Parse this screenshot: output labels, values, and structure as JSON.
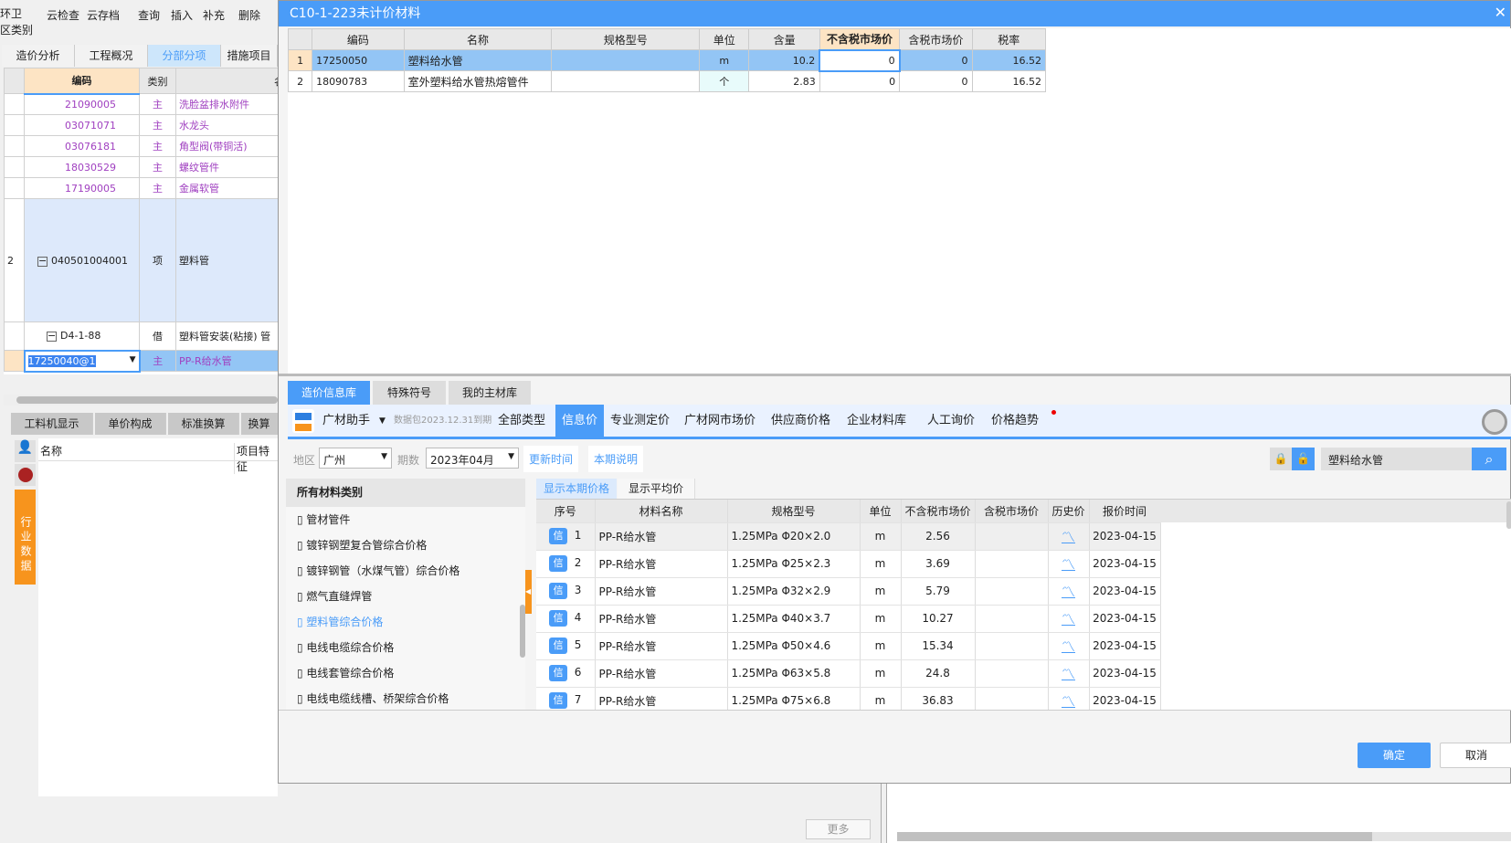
{
  "app": {
    "toolbar": [
      "云检查",
      "云存档",
      "查询",
      "插入",
      "补充",
      "删除"
    ],
    "toolbar_left": [
      "环卫",
      "区类别"
    ],
    "tabs": [
      "造价分析",
      "工程概况",
      "分部分项",
      "措施项目"
    ],
    "grid_headers": [
      "编码",
      "类别",
      "名"
    ],
    "rows": [
      {
        "code": "21090005",
        "type": "主",
        "name": "洗脸盆排水附件"
      },
      {
        "code": "03071071",
        "type": "主",
        "name": "水龙头"
      },
      {
        "code": "03076181",
        "type": "主",
        "name": "角型阀(带铜活)"
      },
      {
        "code": "18030529",
        "type": "主",
        "name": "螺纹管件"
      },
      {
        "code": "17190005",
        "type": "主",
        "name": "金属软管"
      }
    ],
    "item_row": {
      "num": "2",
      "code": "040501004001",
      "type": "项",
      "name": "塑料管"
    },
    "sub_row": {
      "code": "D4-1-88",
      "type": "借",
      "name": "塑料管安装(粘接) 管"
    },
    "edit_row": {
      "code": "17250040@1",
      "type": "主",
      "name": "PP-R给水管"
    },
    "bottom_tabs": [
      "工料机显示",
      "单价构成",
      "标准换算",
      "换算"
    ],
    "bottom_headers": [
      "名称",
      "项目特征"
    ],
    "side_label": "行业数据",
    "more": "更多"
  },
  "dialog": {
    "title": "C10-1-223未计价材料",
    "headers": [
      "编码",
      "名称",
      "规格型号",
      "单位",
      "含量",
      "不含税市场价",
      "含税市场价",
      "税率"
    ],
    "rows": [
      {
        "n": "1",
        "code": "17250050",
        "name": "塑料给水管",
        "spec": "",
        "unit": "m",
        "qty": "10.2",
        "price_ex": "0",
        "price_in": "0",
        "tax": "16.52"
      },
      {
        "n": "2",
        "code": "18090783",
        "name": "室外塑料给水管热熔管件",
        "spec": "",
        "unit": "个",
        "qty": "2.83",
        "price_ex": "0",
        "price_in": "0",
        "tax": "16.52"
      }
    ],
    "tabs": [
      "造价信息库",
      "特殊符号",
      "我的主材库"
    ],
    "assistant": "广材助手",
    "package": "数据包2023.12.31到期",
    "nav": [
      "全部类型",
      "信息价",
      "专业测定价",
      "广材网市场价",
      "供应商价格",
      "企业材料库",
      "人工询价",
      "价格趋势"
    ],
    "region_label": "地区",
    "region": "广州",
    "period_label": "期数",
    "period": "2023年04月",
    "update_time": "更新时间",
    "period_note": "本期说明",
    "search": "塑料给水管",
    "cat_header": "所有材料类别",
    "categories": [
      "管材管件",
      "镀锌钢塑复合管综合价格",
      "镀锌钢管（水煤气管）综合价格",
      "燃气直缝焊管",
      "塑料管综合价格",
      "电线电缆综合价格",
      "电线套管综合价格",
      "电线电缆线槽、桥架综合价格"
    ],
    "selected_category": "塑料管综合价格",
    "subtabs": [
      "显示本期价格",
      "显示平均价"
    ],
    "price_headers": [
      "序号",
      "材料名称",
      "规格型号",
      "单位",
      "不含税市场价",
      "含税市场价",
      "历史价",
      "报价时间"
    ],
    "badge": "信",
    "prices": [
      {
        "n": "1",
        "name": "PP-R给水管",
        "spec": "1.25MPa Φ20×2.0",
        "unit": "m",
        "ex": "2.56",
        "in": "",
        "date": "2023-04-15"
      },
      {
        "n": "2",
        "name": "PP-R给水管",
        "spec": "1.25MPa Φ25×2.3",
        "unit": "m",
        "ex": "3.69",
        "in": "",
        "date": "2023-04-15"
      },
      {
        "n": "3",
        "name": "PP-R给水管",
        "spec": "1.25MPa Φ32×2.9",
        "unit": "m",
        "ex": "5.79",
        "in": "",
        "date": "2023-04-15"
      },
      {
        "n": "4",
        "name": "PP-R给水管",
        "spec": "1.25MPa Φ40×3.7",
        "unit": "m",
        "ex": "10.27",
        "in": "",
        "date": "2023-04-15"
      },
      {
        "n": "5",
        "name": "PP-R给水管",
        "spec": "1.25MPa Φ50×4.6",
        "unit": "m",
        "ex": "15.34",
        "in": "",
        "date": "2023-04-15"
      },
      {
        "n": "6",
        "name": "PP-R给水管",
        "spec": "1.25MPa Φ63×5.8",
        "unit": "m",
        "ex": "24.8",
        "in": "",
        "date": "2023-04-15"
      },
      {
        "n": "7",
        "name": "PP-R给水管",
        "spec": "1.25MPa Φ75×6.8",
        "unit": "m",
        "ex": "36.83",
        "in": "",
        "date": "2023-04-15"
      }
    ],
    "ok": "确定",
    "cancel": "取消"
  },
  "colors": {
    "accent": "#4a9cf8",
    "orange": "#f7941d",
    "purple": "#a040c0"
  }
}
